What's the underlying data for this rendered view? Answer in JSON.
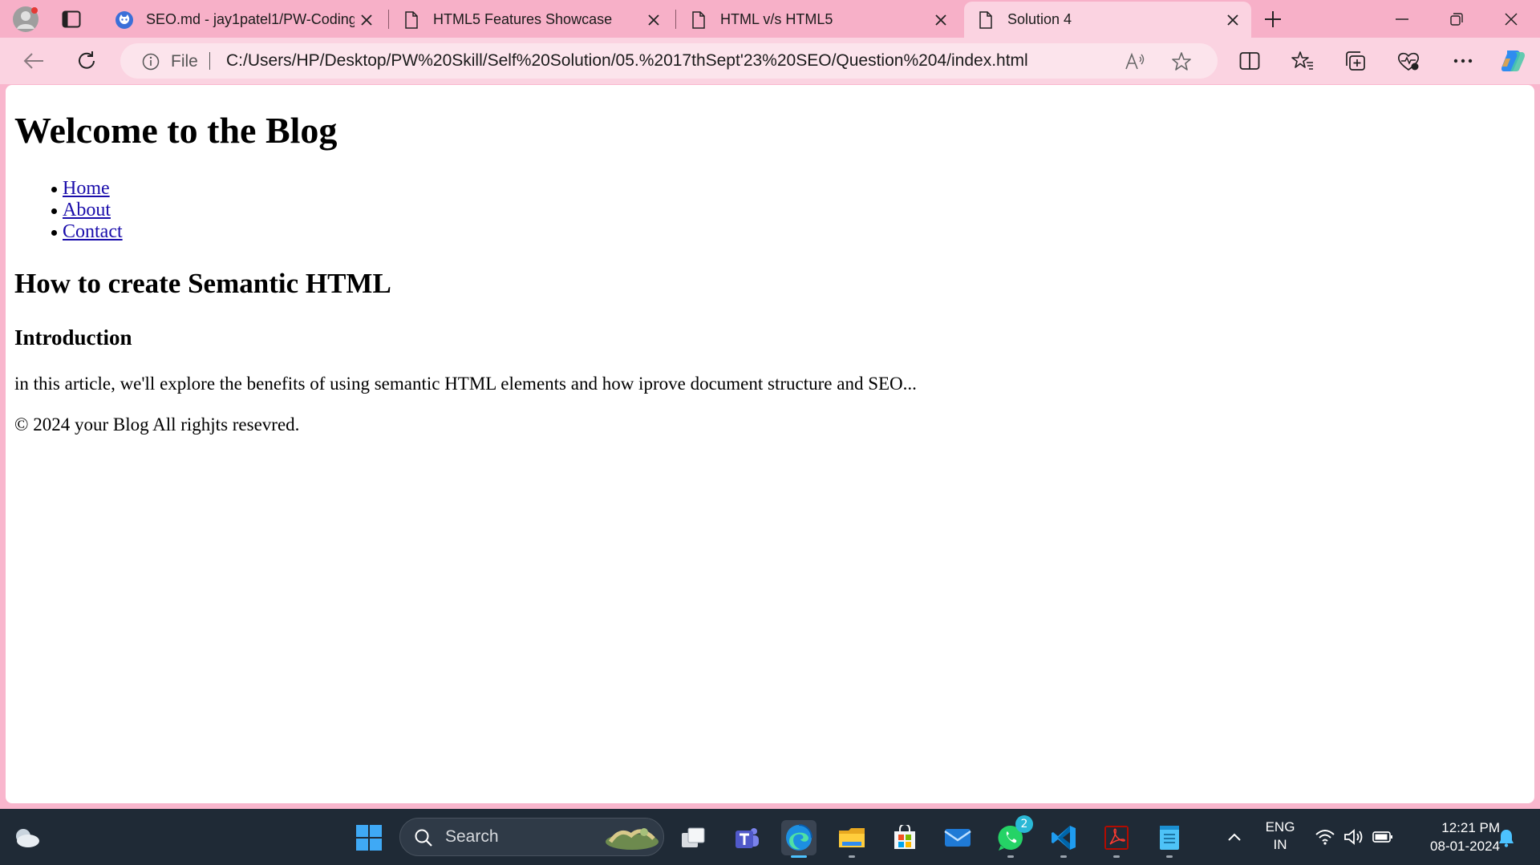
{
  "browser": {
    "tabs": [
      {
        "title": "SEO.md - jay1patel1/PW-Coding",
        "icon": "github-icon",
        "active": false
      },
      {
        "title": "HTML5 Features Showcase",
        "icon": "page-icon",
        "active": false
      },
      {
        "title": "HTML v/s HTML5",
        "icon": "page-icon",
        "active": false
      },
      {
        "title": "Solution 4",
        "icon": "page-icon",
        "active": true
      }
    ],
    "address": {
      "scheme_label": "File",
      "url": "C:/Users/HP/Desktop/PW%20Skill/Self%20Solution/05.%2017thSept'23%20SEO/Question%204/index.html"
    },
    "colors": {
      "chrome": "#f7b0c8",
      "active_tab": "#fbd3e1",
      "omnibox": "#fce4ec"
    }
  },
  "page": {
    "heading": "Welcome to the Blog",
    "nav": [
      {
        "label": "Home"
      },
      {
        "label": "About"
      },
      {
        "label": "Contact"
      }
    ],
    "article_title": "How to create Semantic HTML",
    "section_title": "Introduction",
    "paragraph": "in this article, we'll explore the benefits of using semantic HTML elements and how iprove document structure and SEO...",
    "footer": "© 2024 your Blog All righjts resevred.",
    "link_color": "#1a0dab"
  },
  "taskbar": {
    "search_placeholder": "Search",
    "whatsapp_badge": "2",
    "language": {
      "line1": "ENG",
      "line2": "IN"
    },
    "clock": {
      "time": "12:21 PM",
      "date": "08-01-2024"
    },
    "colors": {
      "background": "#1f2a36",
      "accent": "#4cc2ff"
    }
  }
}
